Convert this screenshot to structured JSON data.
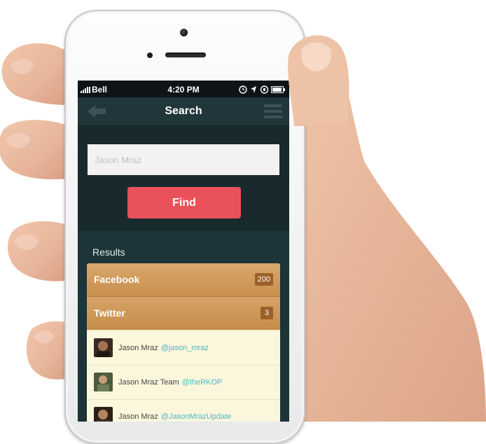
{
  "statusbar": {
    "carrier": "Bell",
    "time": "4:20 PM"
  },
  "navbar": {
    "title": "Search"
  },
  "search": {
    "placeholder": "Jason Mraz",
    "find_label": "Find"
  },
  "results": {
    "label": "Results",
    "groups": [
      {
        "label": "Facebook",
        "count": "200"
      },
      {
        "label": "Twitter",
        "count": "3"
      }
    ],
    "items": [
      {
        "name": "Jason Mraz",
        "handle": "@jason_mraz"
      },
      {
        "name": "Jason Mraz Team",
        "handle": "@theRKOP"
      },
      {
        "name": "Jason Mraz",
        "handle": "@JasonMrazUpdate"
      }
    ]
  },
  "colors": {
    "accent_red": "#e9525a",
    "header_bg": "#21363b",
    "group_row": "#d8a86b",
    "handle_text": "#4ab7c4"
  },
  "icons": [
    "back-arrow-icon",
    "menu-icon",
    "signal-icon",
    "lock-icon",
    "location-icon",
    "alarm-icon",
    "battery-icon"
  ]
}
